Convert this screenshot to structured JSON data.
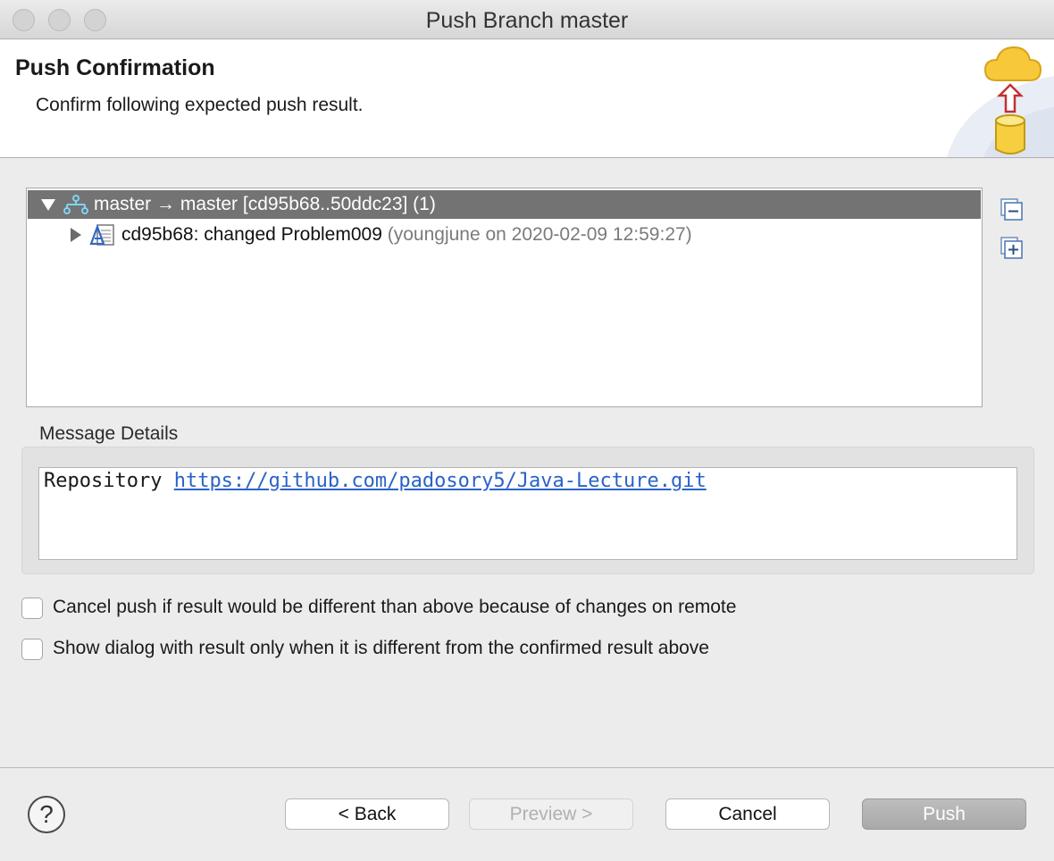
{
  "window": {
    "title": "Push Branch master"
  },
  "header": {
    "title": "Push Confirmation",
    "description": "Confirm following expected push result."
  },
  "tree": {
    "branch_row": {
      "label": "master → master [cd95b68..50ddc23] (1)",
      "icon": "branch-icon"
    },
    "commit_row": {
      "label": "cd95b68: changed Problem009",
      "meta": "(youngjune on 2020-02-09 12:59:27)",
      "icon": "commit-icon"
    }
  },
  "side_buttons": {
    "collapse": "collapse-all-icon",
    "expand": "expand-all-icon"
  },
  "message": {
    "label": "Message Details",
    "prefix": "Repository ",
    "url": "https://github.com/padosory5/Java-Lecture.git"
  },
  "options": [
    {
      "label": "Cancel push if result would be different than above because of changes on remote",
      "checked": false
    },
    {
      "label": "Show dialog with result only when it is different from the confirmed result above",
      "checked": false
    }
  ],
  "footer": {
    "help": "?",
    "back": "< Back",
    "preview": "Preview >",
    "cancel": "Cancel",
    "push": "Push"
  },
  "colors": {
    "selection": "#737373",
    "link": "#2a62c9",
    "push_button": "#b0b0b0"
  }
}
